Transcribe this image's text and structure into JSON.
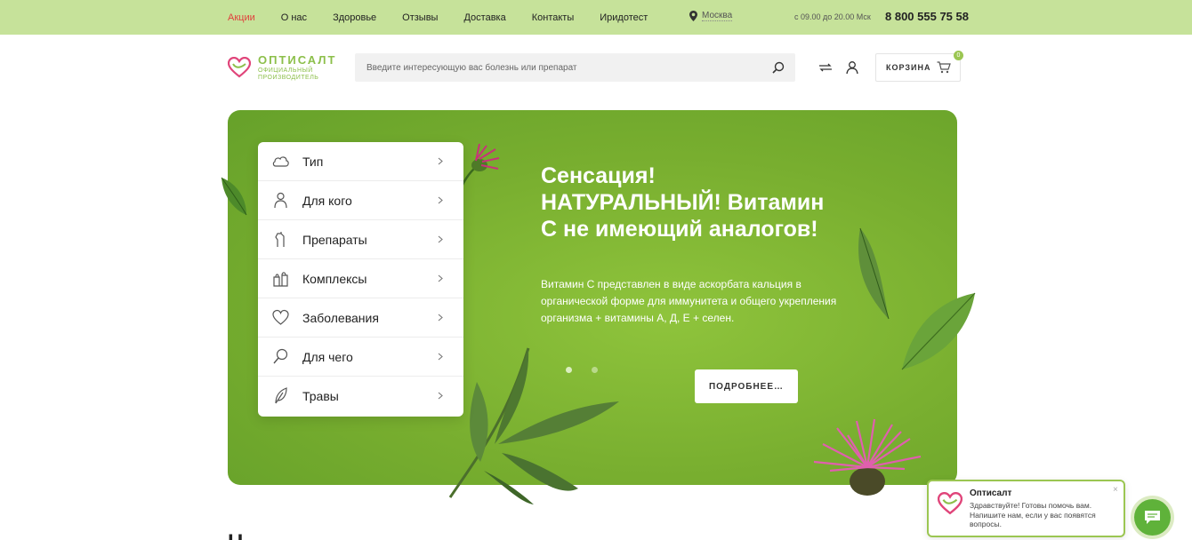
{
  "topbar": {
    "nav": [
      {
        "label": "Акции",
        "active": true
      },
      {
        "label": "О нас"
      },
      {
        "label": "Здоровье"
      },
      {
        "label": "Отзывы"
      },
      {
        "label": "Доставка"
      },
      {
        "label": "Контакты"
      },
      {
        "label": "Иридотест"
      }
    ],
    "city": "Москва",
    "hours": "с 09.00 до 20.00 Мск",
    "phone": "8 800 555 75 58"
  },
  "header": {
    "logo_brand": "ОПТИСАЛТ",
    "logo_sub_1": "ОФИЦИАЛЬНЫЙ",
    "logo_sub_2": "ПРОИЗВОДИТЕЛЬ",
    "search_placeholder": "Введите интересующую вас болезнь или препарат",
    "cart_label": "КОРЗИНА",
    "cart_count": "0"
  },
  "menu": {
    "items": [
      {
        "label": "Тип",
        "icon": "cloud-icon"
      },
      {
        "label": "Для кого",
        "icon": "person-icon"
      },
      {
        "label": "Препараты",
        "icon": "hand-icon"
      },
      {
        "label": "Комплексы",
        "icon": "bag-icon"
      },
      {
        "label": "Заболевания",
        "icon": "heart-icon"
      },
      {
        "label": "Для чего",
        "icon": "magnifier-icon"
      },
      {
        "label": "Травы",
        "icon": "leaf-icon"
      }
    ]
  },
  "hero": {
    "title": "Сенсация! НАТУРАЛЬНЫЙ! Витамин С не имеющий аналогов!",
    "text": "Витамин С представлен в виде аскорбата кальция в органической форме для иммунитета и общего укрепления организма + витамины А, Д, Е + селен.",
    "button": "ПОДРОБНЕЕ…",
    "slides": 2,
    "active_slide": 1
  },
  "bottom_heading": "Н",
  "chat": {
    "name": "Оптисалт",
    "message": "Здравствуйте! Готовы помочь вам. Напишите нам, если у вас появятся вопросы.",
    "close": "×"
  },
  "colors": {
    "topbar": "#c6e29a",
    "hero": "#78ae2f",
    "accent": "#9bc652",
    "active_link": "#e0413d"
  }
}
